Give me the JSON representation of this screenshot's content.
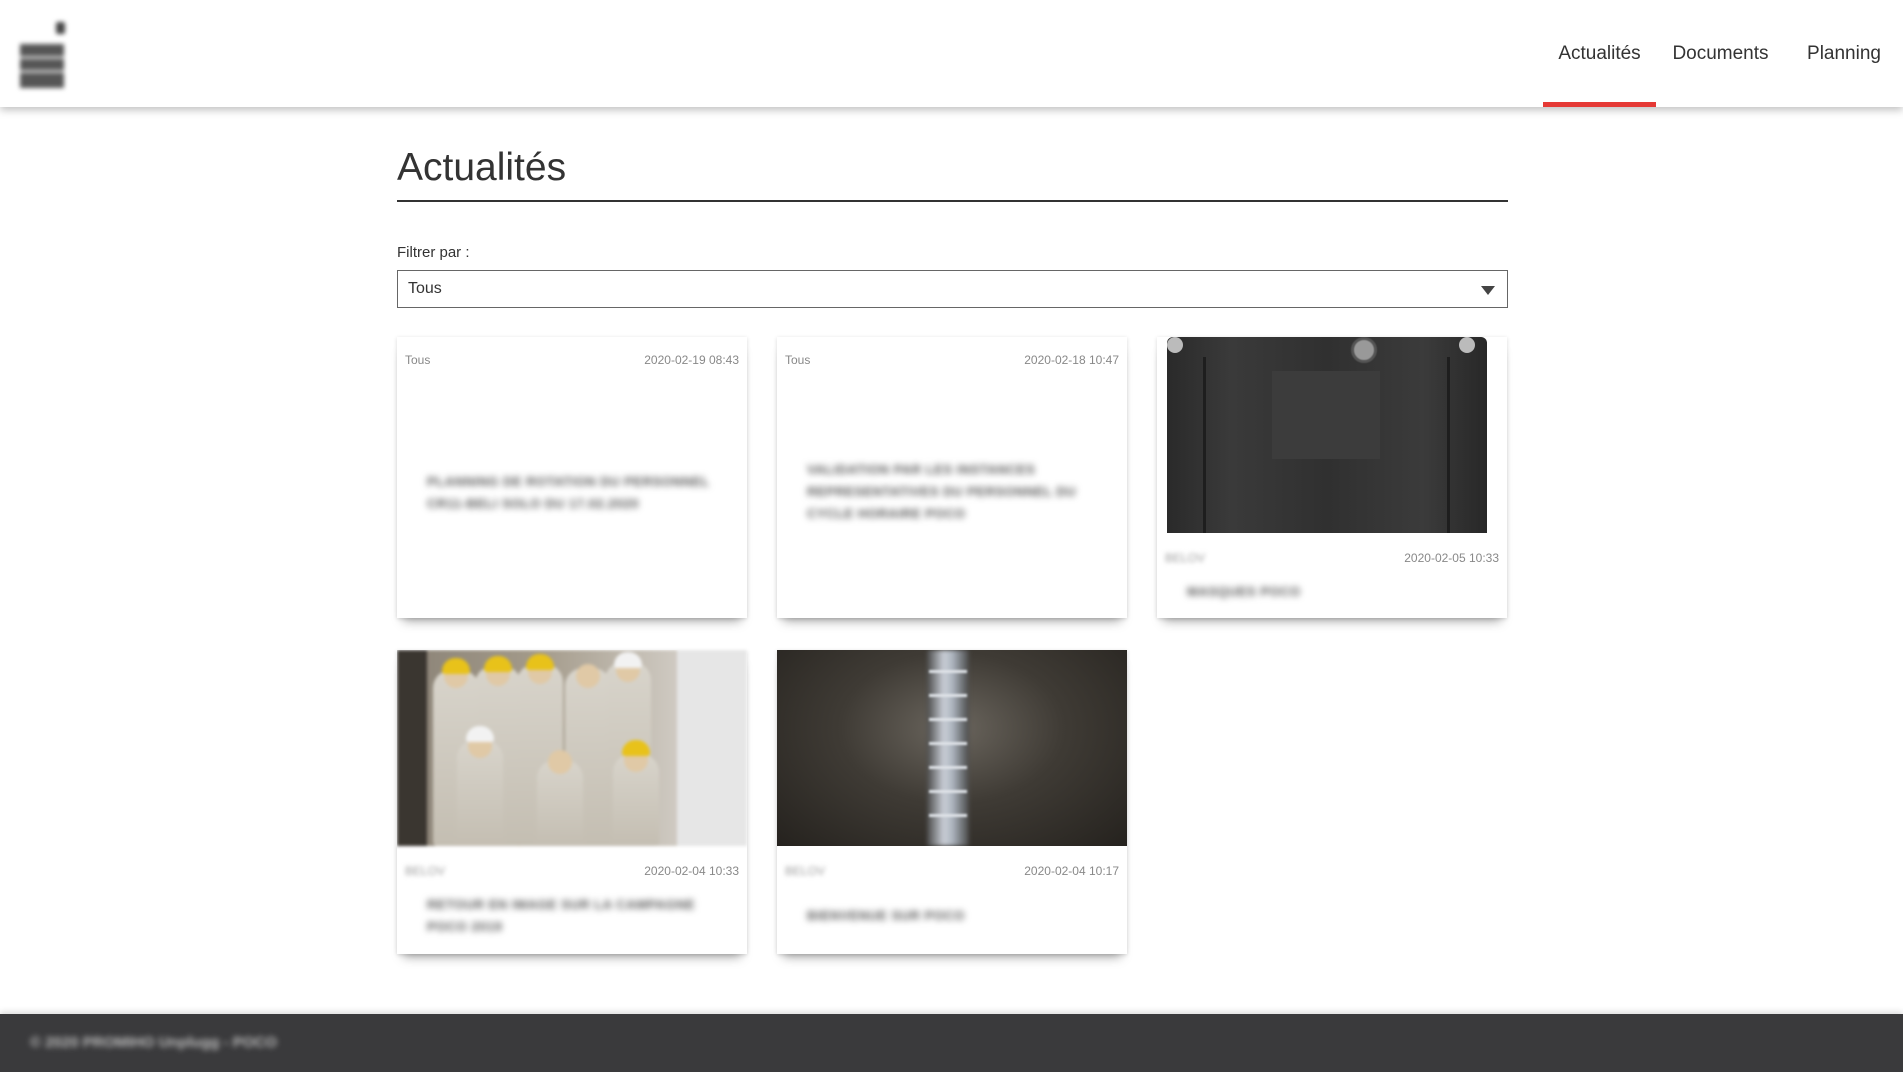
{
  "header": {
    "nav": [
      {
        "label": "Actualités",
        "active": true
      },
      {
        "label": "Documents",
        "active": false
      },
      {
        "label": "Planning",
        "active": false
      }
    ],
    "accent_color": "#e53935"
  },
  "page": {
    "title": "Actualités",
    "filter_label": "Filtrer par :",
    "filter_value": "Tous"
  },
  "cards": [
    {
      "tag": "Tous",
      "date": "2020-02-19 08:43",
      "text": "PLANNING DE ROTATION DU PERSONNEL CR11-BELI SOLO DU 17.02.2020",
      "image": "none"
    },
    {
      "tag": "Tous",
      "date": "2020-02-18 10:47",
      "text": "VALIDATION PAR LES INSTANCES REPRESENTATIVES DU PERSONNEL DU CYCLE HORAIRE POCO",
      "image": "none"
    },
    {
      "tag": "BELOV",
      "date": "2020-02-05 10:33",
      "text": "MASQUES POCO",
      "image": "jacket"
    },
    {
      "tag": "BELOV",
      "date": "2020-02-04 10:33",
      "text": "RETOUR EN IMAGE SUR LA CAMPAGNE POCO 2019",
      "image": "group-photo"
    },
    {
      "tag": "BELOV",
      "date": "2020-02-04 10:17",
      "text": "BIENVENUE SUR POCO",
      "image": "mine-shaft"
    }
  ],
  "footer": {
    "text": "© 2020 PROMIHO Unplugg - POCO"
  }
}
